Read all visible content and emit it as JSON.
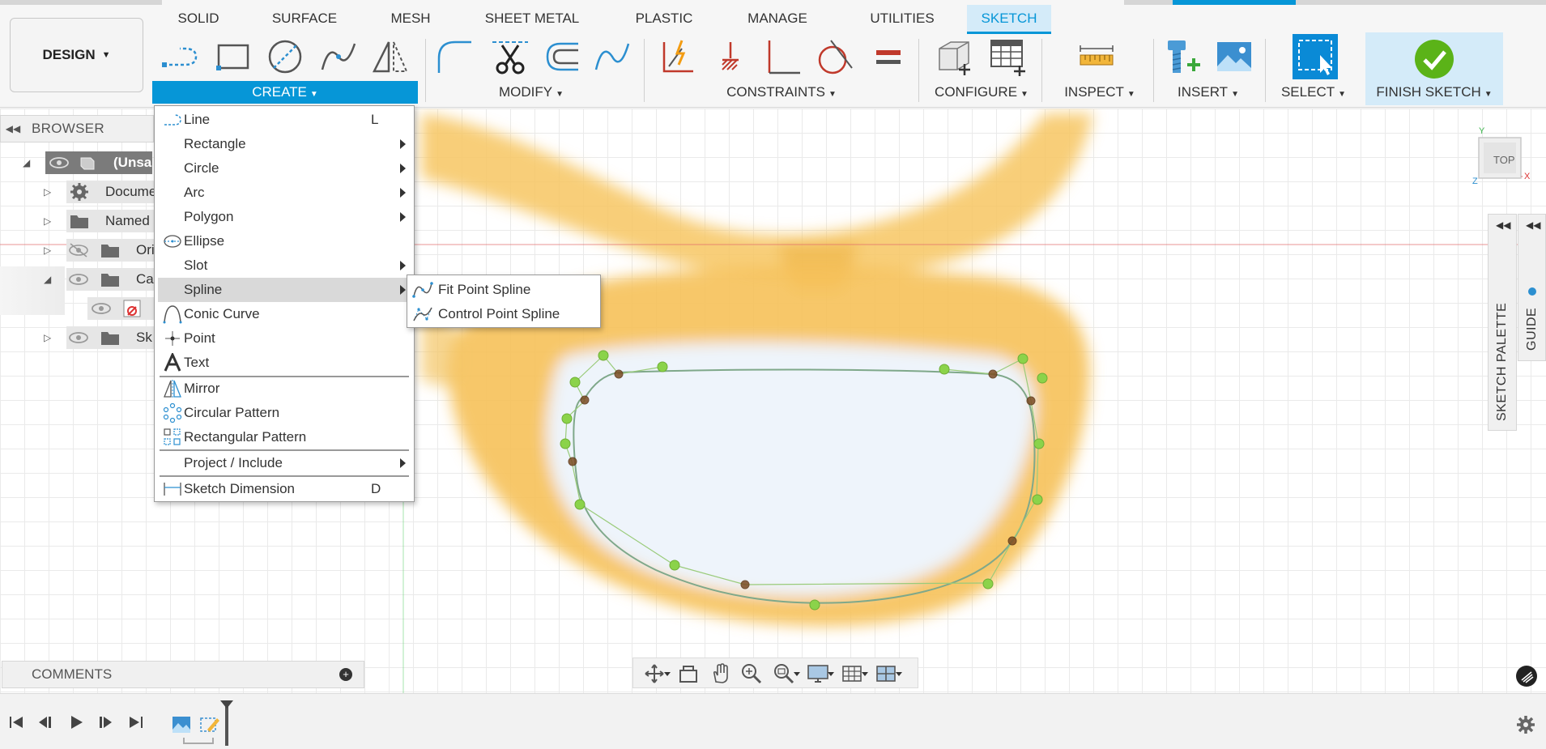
{
  "workspace": {
    "label": "DESIGN"
  },
  "tabs": [
    {
      "label": "SOLID"
    },
    {
      "label": "SURFACE"
    },
    {
      "label": "MESH"
    },
    {
      "label": "SHEET METAL"
    },
    {
      "label": "PLASTIC"
    },
    {
      "label": "MANAGE"
    },
    {
      "label": "UTILITIES"
    },
    {
      "label": "SKETCH",
      "active": true
    }
  ],
  "groups": {
    "create": "CREATE",
    "modify": "MODIFY",
    "constraints": "CONSTRAINTS",
    "configure": "CONFIGURE",
    "inspect": "INSPECT",
    "insert": "INSERT",
    "select": "SELECT",
    "finish": "FINISH SKETCH"
  },
  "browser": {
    "title": "BROWSER",
    "items": [
      {
        "label": "(Unsa"
      },
      {
        "label": "Docume"
      },
      {
        "label": "Named"
      },
      {
        "label": "Ori"
      },
      {
        "label": "Ca"
      },
      {
        "label": "Sk"
      }
    ]
  },
  "create_menu": {
    "items": [
      {
        "label": "Line",
        "shortcut": "L"
      },
      {
        "label": "Rectangle"
      },
      {
        "label": "Circle"
      },
      {
        "label": "Arc"
      },
      {
        "label": "Polygon"
      },
      {
        "label": "Ellipse"
      },
      {
        "label": "Slot"
      },
      {
        "label": "Spline",
        "highlighted": true
      },
      {
        "label": "Conic Curve"
      },
      {
        "label": "Point"
      },
      {
        "label": "Text"
      },
      {
        "label": "Mirror"
      },
      {
        "label": "Circular Pattern"
      },
      {
        "label": "Rectangular Pattern"
      },
      {
        "label": "Project / Include"
      },
      {
        "label": "Sketch Dimension",
        "shortcut": "D"
      }
    ],
    "spline_submenu": [
      {
        "label": "Fit Point Spline"
      },
      {
        "label": "Control Point Spline"
      }
    ]
  },
  "viewcube": {
    "face": "TOP",
    "axis_y": "Y",
    "axis_x": "X",
    "axis_z": "Z"
  },
  "right_panels": {
    "sketch_palette": "SKETCH PALETTE",
    "guide": "GUIDE"
  },
  "comments": {
    "title": "COMMENTS"
  },
  "colors": {
    "accent": "#0696d7",
    "active_tab_bg": "#d4ebf9",
    "finish_green": "#5bb318",
    "spline_point": "#8bd34a",
    "sketch_line": "#7fa88a",
    "frame_orange": "#f3b845"
  }
}
